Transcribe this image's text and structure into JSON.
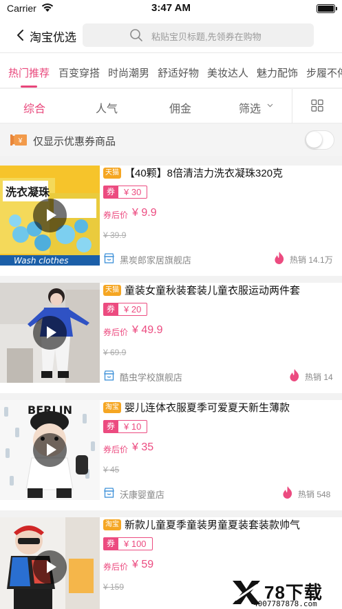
{
  "status_bar": {
    "carrier": "Carrier",
    "time": "3:47 AM"
  },
  "nav": {
    "title": "淘宝优选",
    "search_placeholder": "粘贴宝贝标题,先领券在购物"
  },
  "categories": [
    "热门推荐",
    "百变穿搭",
    "时尚潮男",
    "舒适好物",
    "美妆达人",
    "魅力配饰",
    "步履不停"
  ],
  "active_category": 0,
  "sort": {
    "items": [
      "综合",
      "人气",
      "佣金",
      "筛选"
    ],
    "active": 0
  },
  "coupon_filter": {
    "label": "仅显示优惠券商品",
    "enabled": false
  },
  "products": [
    {
      "badge": "天猫",
      "title": "【40颗】8倍清洁力洗衣凝珠320克",
      "coupon_tag": "券",
      "coupon_amount": "¥ 30",
      "final_label": "券后价",
      "final_price": "¥ 9.9",
      "orig_price": "¥ 39.9",
      "store": "黑炭郎家居旗舰店",
      "sales": "热销 14.1万"
    },
    {
      "badge": "天猫",
      "title": "童装女童秋装套装儿童衣服运动两件套",
      "coupon_tag": "券",
      "coupon_amount": "¥ 20",
      "final_label": "券后价",
      "final_price": "¥ 49.9",
      "orig_price": "¥ 69.9",
      "store": "酷虫学校旗舰店",
      "sales": "热销 14"
    },
    {
      "badge": "淘宝",
      "title": "婴儿连体衣服夏季可爱夏天新生薄款",
      "coupon_tag": "券",
      "coupon_amount": "¥ 10",
      "final_label": "券后价",
      "final_price": "¥ 35",
      "orig_price": "¥ 45",
      "store": "沃康婴童店",
      "sales": "热销 548"
    },
    {
      "badge": "淘宝",
      "title": "新款儿童夏季童装男童夏装套装款帅气",
      "coupon_tag": "券",
      "coupon_amount": "¥ 100",
      "final_label": "券后价",
      "final_price": "¥ 59",
      "orig_price": "¥ 159",
      "store": "",
      "sales": ""
    }
  ],
  "thumb_text": {
    "p1_box": "洗衣凝珠",
    "p1_bottom": "Wash clothes",
    "p3_cap": "BERLIN"
  },
  "watermark": {
    "brand": "78下载",
    "phone": "4007787878.com"
  },
  "colors": {
    "accent": "#e8457a",
    "tmall_badge": "#f5a623",
    "taobao_badge": "#f5a623"
  }
}
